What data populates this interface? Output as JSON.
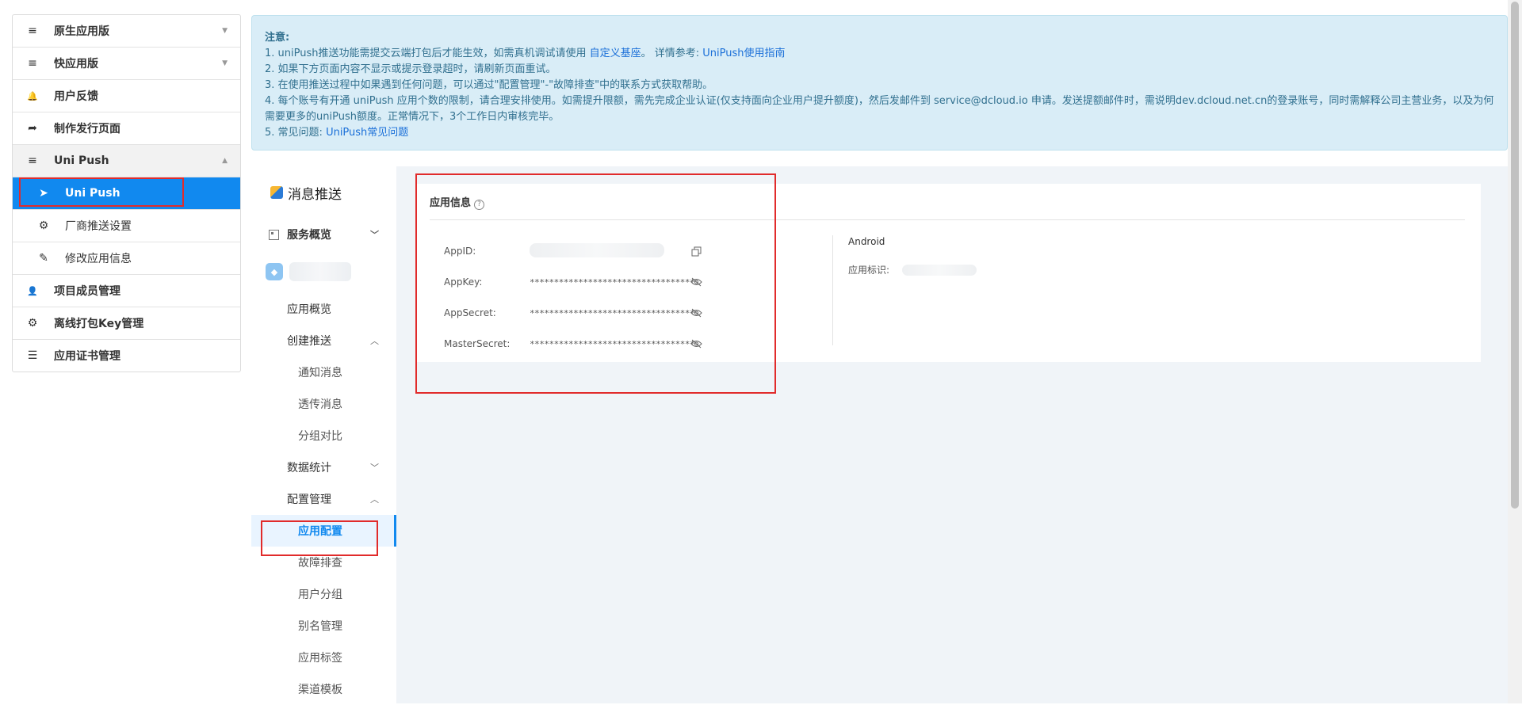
{
  "sidebar": {
    "items": [
      {
        "icon": "≡",
        "icon_name": "menu-icon",
        "label": "原生应用版",
        "caret": "▼"
      },
      {
        "icon": "≡",
        "icon_name": "menu-icon",
        "label": "快应用版",
        "caret": "▼"
      },
      {
        "icon": "🔔",
        "icon_name": "bell-icon",
        "label": "用户反馈",
        "caret": ""
      },
      {
        "icon": "➦",
        "icon_name": "share-icon",
        "label": "制作发行页面",
        "caret": ""
      },
      {
        "icon": "≡",
        "icon_name": "menu-icon",
        "label": "Uni Push",
        "caret": "▲"
      },
      {
        "icon": "➤",
        "icon_name": "paper-plane-icon",
        "label": "Uni Push",
        "caret": ""
      },
      {
        "icon": "⚙",
        "icon_name": "gear-icon",
        "label": "厂商推送设置",
        "caret": ""
      },
      {
        "icon": "✎",
        "icon_name": "edit-icon",
        "label": "修改应用信息",
        "caret": ""
      },
      {
        "icon": "👤",
        "icon_name": "user-icon",
        "label": "项目成员管理",
        "caret": ""
      },
      {
        "icon": "⚙",
        "icon_name": "gear-icon",
        "label": "离线打包Key管理",
        "caret": ""
      },
      {
        "icon": "☰",
        "icon_name": "list-icon",
        "label": "应用证书管理",
        "caret": ""
      }
    ]
  },
  "notice": {
    "title": "注意:",
    "line1_pre": "1. uniPush推送功能需提交云端打包后才能生效，如需真机调试请使用 ",
    "line1_link1": "自定义基座",
    "line1_mid": "。 详情参考: ",
    "line1_link2": "UniPush使用指南",
    "line2": "2. 如果下方页面内容不显示或提示登录超时，请刷新页面重试。",
    "line3": "3. 在使用推送过程中如果遇到任何问题，可以通过\"配置管理\"-\"故障排查\"中的联系方式获取帮助。",
    "line4": "4. 每个账号有开通 uniPush 应用个数的限制，请合理安排使用。如需提升限额，需先完成企业认证(仅支持面向企业用户提升额度)，然后发邮件到 service@dcloud.io 申请。发送提额邮件时，需说明dev.dcloud.net.cn的登录账号，同时需解释公司主营业务，以及为何需要更多的uniPush额度。正常情况下，3个工作日内审核完毕。",
    "line5_pre": "5. 常见问题: ",
    "line5_link": "UniPush常见问题"
  },
  "push_nav": {
    "title": "消息推送",
    "service_overview": "服务概览",
    "app_overview": "应用概览",
    "create_push": "创建推送",
    "notify_msg": "通知消息",
    "passthrough_msg": "透传消息",
    "group_compare": "分组对比",
    "data_stats": "数据统计",
    "config_mgmt": "配置管理",
    "app_config": "应用配置",
    "troubleshoot": "故障排查",
    "user_group": "用户分组",
    "alias_mgmt": "别名管理",
    "app_tags": "应用标签",
    "channel_template": "渠道模板"
  },
  "app_info": {
    "title": "应用信息",
    "help": "?",
    "appid_label": "AppID:",
    "appkey_label": "AppKey:",
    "appkey_value": "**********************************",
    "appsecret_label": "AppSecret:",
    "appsecret_value": "**********************************",
    "mastersecret_label": "MasterSecret:",
    "mastersecret_value": "**********************************",
    "platform": "Android",
    "package_label": "应用标识:"
  },
  "colors": {
    "accent": "#1189ef",
    "notice_bg": "#d9edf7",
    "highlight": "#e12b2b"
  }
}
